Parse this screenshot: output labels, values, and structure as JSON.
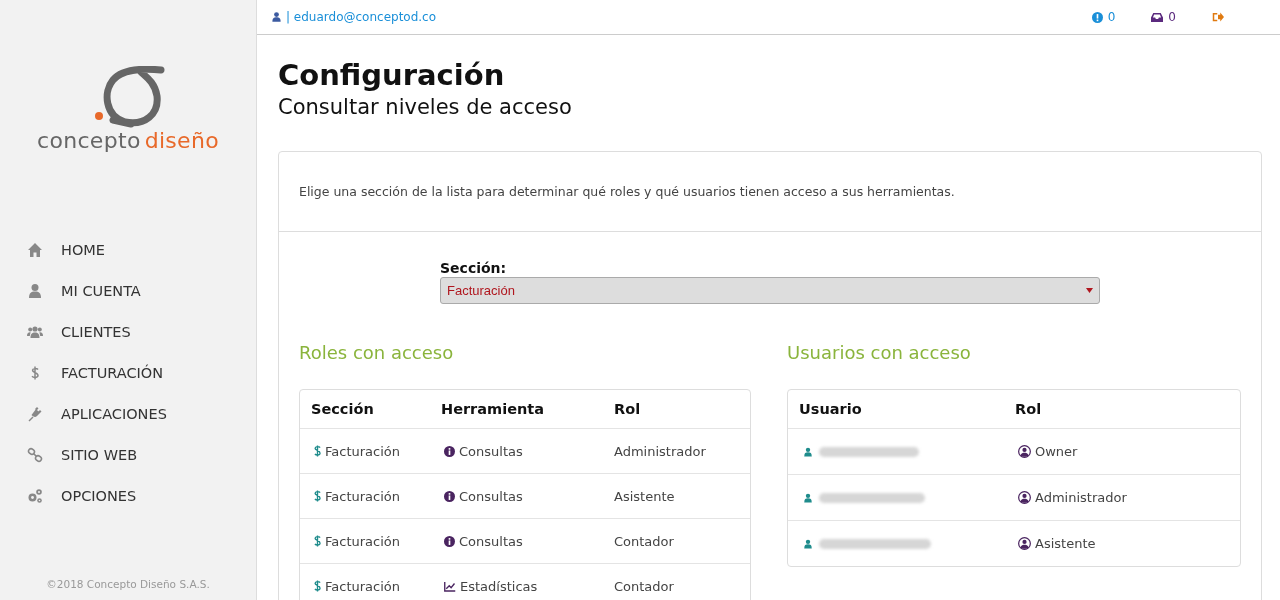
{
  "sidebar": {
    "logo": {
      "word1": "concepto",
      "word2": "diseño"
    },
    "menu": [
      {
        "label": "HOME"
      },
      {
        "label": "MI CUENTA"
      },
      {
        "label": "CLIENTES"
      },
      {
        "label": "FACTURACIÓN"
      },
      {
        "label": "APLICACIONES"
      },
      {
        "label": "SITIO WEB"
      },
      {
        "label": "OPCIONES"
      }
    ],
    "footer": "©2018 Concepto Diseño S.A.S."
  },
  "topbar": {
    "user": "| eduardo@conceptod.co",
    "alerts": "0",
    "inbox": "0"
  },
  "page": {
    "title": "Configuración",
    "subtitle": "Consultar niveles de acceso",
    "intro": "Elige una sección de la lista para determinar qué roles y qué usuarios tienen acceso a sus herramientas.",
    "section_label": "Sección:",
    "section_value": "Facturación"
  },
  "roles": {
    "heading": "Roles con acceso",
    "columns": [
      "Sección",
      "Herramienta",
      "Rol"
    ],
    "rows": [
      {
        "kind": "info",
        "section": "Facturación",
        "tool": "Consultas",
        "role": "Administrador"
      },
      {
        "kind": "info",
        "section": "Facturación",
        "tool": "Consultas",
        "role": "Asistente"
      },
      {
        "kind": "info",
        "section": "Facturación",
        "tool": "Consultas",
        "role": "Contador"
      },
      {
        "kind": "chart",
        "section": "Facturación",
        "tool": "Estadísticas",
        "role": "Contador"
      }
    ]
  },
  "users": {
    "heading": "Usuarios con acceso",
    "columns": [
      "Usuario",
      "Rol"
    ],
    "rows": [
      {
        "role": "Owner"
      },
      {
        "role": "Administrador"
      },
      {
        "role": "Asistente"
      }
    ]
  }
}
